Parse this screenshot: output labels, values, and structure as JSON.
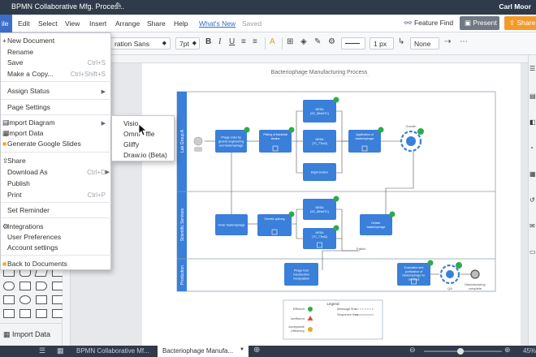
{
  "app": {
    "doc_title": "BPMN Collaborative Mfg. Proces...",
    "user": "Carl Moor",
    "colors": {
      "accent": "#3d6ec8",
      "share": "#f39a2b",
      "present": "#6f7884",
      "task": "#3a7fd9",
      "check": "#2eaa4a"
    }
  },
  "menu": {
    "file": "ile",
    "edit": "Edit",
    "select": "Select",
    "view": "View",
    "insert": "Insert",
    "arrange": "Arrange",
    "share": "Share",
    "help": "Help",
    "whats_new": "What's New",
    "saved": "Saved"
  },
  "header_actions": {
    "feature_find": "Feature Find",
    "present": "Present",
    "share": "Share"
  },
  "toolbar": {
    "font": "ration Sans",
    "size": "7pt",
    "bold": "B",
    "italic": "I",
    "underline": "U",
    "line_width": "1 px",
    "arrow_none": "None"
  },
  "file_menu": {
    "new_document": "New Document",
    "rename": "Rename",
    "save": "Save",
    "save_sc": "Ctrl+S",
    "make_copy": "Make a Copy...",
    "make_copy_sc": "Ctrl+Shift+S",
    "assign_status": "Assign Status",
    "page_settings": "Page Settings",
    "import_diagram": "Import Diagram",
    "import_data": "Import Data",
    "generate_slides": "Generate Google Slides",
    "share": "Share",
    "download_as": "Download As",
    "download_sc": "Ctrl+D",
    "publish": "Publish",
    "print": "Print",
    "print_sc": "Ctrl+P",
    "set_reminder": "Set Reminder",
    "integrations": "Integrations",
    "user_prefs": "User Preferences",
    "account_settings": "Account settings",
    "back_to_docs": "Back to Documents"
  },
  "import_submenu": {
    "visio": "Visio",
    "omni": "Omni",
    "omni_tail": "ffle",
    "gliffy": "Gliffy",
    "drawio": "Draw.io (Beta)"
  },
  "left_panel": {
    "import_data": "Import Data"
  },
  "diagram": {
    "title": "Bacteriophage Manufacturing Process",
    "lanes": [
      "Lab Group A",
      "Scientific Services",
      "Production"
    ],
    "tasks": {
      "t1": [
        "Phage order by",
        "genetic engineering",
        "and bacteriophage"
      ],
      "t2": [
        "Plating of bacterial",
        "strains"
      ],
      "t3": [
        "NRSA",
        "(SC_654ef7C)"
      ],
      "t4": [
        "NRSA",
        "(TC_7Ted2)"
      ],
      "t5": [
        "Elight section"
      ],
      "t6": [
        "Application of",
        "bacteriophage"
      ],
      "t7": [
        "Order bacteriophage"
      ],
      "t8": [
        "Genetic splicing"
      ],
      "t9": [
        "NRSA",
        "(SC_654ef7C)"
      ],
      "t10": [
        "NRSA",
        "(TC_7Ted2)"
      ],
      "t11": [
        "Deliver",
        "bacteriophage"
      ],
      "t12": [
        "Phage host",
        "transduction",
        "manipulation"
      ],
      "t13": [
        "Evaluation and",
        "purification of",
        "bacteriophage for",
        "cell lines"
      ]
    },
    "labels": {
      "growth": "Growth",
      "qa": "QA",
      "failed": "Failed",
      "complete": [
        "Manufacturing",
        "complete"
      ]
    },
    "legend": {
      "title": "Legend",
      "efficient": "Efficient",
      "inefficient": "Inefficient",
      "acceptable": [
        "Acceptable",
        "efficiency"
      ],
      "message_flow": "Message flow",
      "sequence_flow": "Sequence flow"
    }
  },
  "status_bar": {
    "tab1": "BPMN Collaborative Mf...",
    "tab2": "Bacteriophage Manufa...",
    "zoom": "45%"
  }
}
